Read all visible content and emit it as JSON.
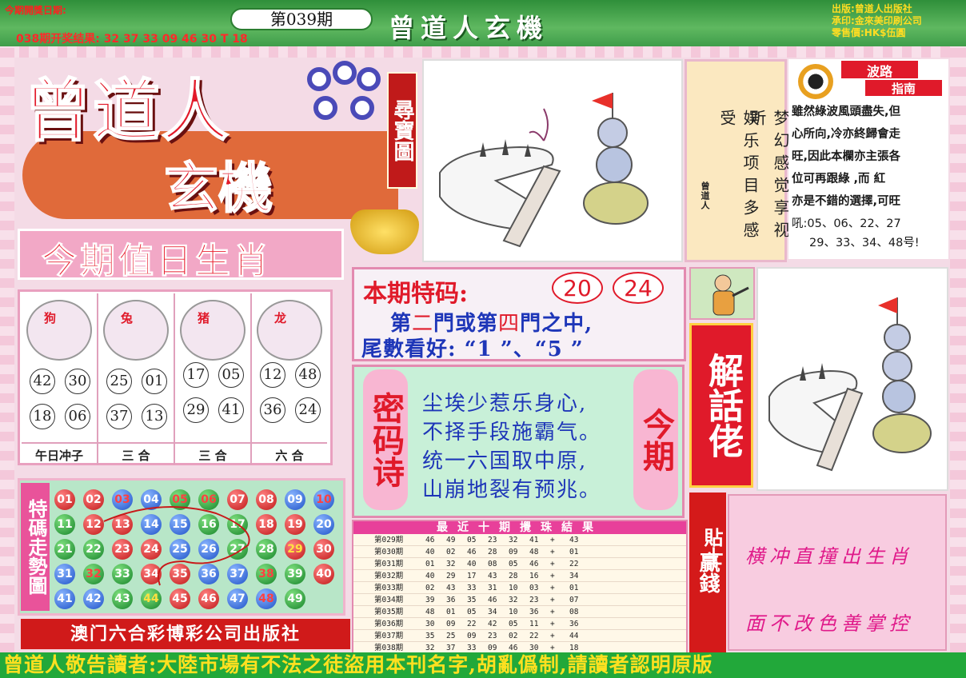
{
  "header": {
    "date_label": "今期開獎日期:",
    "last_result": "038期开奖结果: 32 37 33 09 46 30 T 18",
    "issue": "第039期",
    "title": "曾道人玄機",
    "publisher_lines": [
      "出版:曾道人出版社",
      "承印:金來美印刷公司",
      "零售價:HK$伍圓"
    ]
  },
  "logo": {
    "main": "曾道人",
    "sub": "玄機",
    "treasure_map": "尋寶圖"
  },
  "zodiac": {
    "title": "今期值日生肖",
    "columns": [
      {
        "animal": "狗",
        "numbers": [
          "42",
          "30",
          "18",
          "06"
        ],
        "label": "午日冲子"
      },
      {
        "animal": "兔",
        "numbers": [
          "25",
          "01",
          "37",
          "13"
        ],
        "label": "三 合"
      },
      {
        "animal": "猪",
        "numbers": [
          "17",
          "05",
          "29",
          "41"
        ],
        "label": "三 合"
      },
      {
        "animal": "龙",
        "numbers": [
          "12",
          "48",
          "36",
          "24"
        ],
        "label": "六 合"
      }
    ]
  },
  "trend": {
    "title": "特碼走勢圖",
    "balls": [
      {
        "n": "01",
        "c": "red"
      },
      {
        "n": "02",
        "c": "red"
      },
      {
        "n": "03",
        "c": "blue",
        "hl": "r"
      },
      {
        "n": "04",
        "c": "blue"
      },
      {
        "n": "05",
        "c": "green",
        "hl": "r"
      },
      {
        "n": "06",
        "c": "green",
        "hl": "r"
      },
      {
        "n": "07",
        "c": "red"
      },
      {
        "n": "08",
        "c": "red"
      },
      {
        "n": "09",
        "c": "blue"
      },
      {
        "n": "10",
        "c": "blue",
        "hl": "r"
      },
      {
        "n": "11",
        "c": "green"
      },
      {
        "n": "12",
        "c": "red"
      },
      {
        "n": "13",
        "c": "red"
      },
      {
        "n": "14",
        "c": "blue"
      },
      {
        "n": "15",
        "c": "blue"
      },
      {
        "n": "16",
        "c": "green"
      },
      {
        "n": "17",
        "c": "green"
      },
      {
        "n": "18",
        "c": "red"
      },
      {
        "n": "19",
        "c": "red"
      },
      {
        "n": "20",
        "c": "blue"
      },
      {
        "n": "21",
        "c": "green"
      },
      {
        "n": "22",
        "c": "green"
      },
      {
        "n": "23",
        "c": "red"
      },
      {
        "n": "24",
        "c": "red"
      },
      {
        "n": "25",
        "c": "blue"
      },
      {
        "n": "26",
        "c": "blue"
      },
      {
        "n": "27",
        "c": "green"
      },
      {
        "n": "28",
        "c": "green"
      },
      {
        "n": "29",
        "c": "red",
        "hl": "y"
      },
      {
        "n": "30",
        "c": "red"
      },
      {
        "n": "31",
        "c": "blue"
      },
      {
        "n": "32",
        "c": "green",
        "hl": "r"
      },
      {
        "n": "33",
        "c": "green"
      },
      {
        "n": "34",
        "c": "red"
      },
      {
        "n": "35",
        "c": "red"
      },
      {
        "n": "36",
        "c": "blue"
      },
      {
        "n": "37",
        "c": "blue"
      },
      {
        "n": "38",
        "c": "green",
        "hl": "r"
      },
      {
        "n": "39",
        "c": "green"
      },
      {
        "n": "40",
        "c": "red"
      },
      {
        "n": "41",
        "c": "blue"
      },
      {
        "n": "42",
        "c": "blue"
      },
      {
        "n": "43",
        "c": "green"
      },
      {
        "n": "44",
        "c": "green",
        "hl": "y"
      },
      {
        "n": "45",
        "c": "red"
      },
      {
        "n": "46",
        "c": "red"
      },
      {
        "n": "47",
        "c": "blue"
      },
      {
        "n": "48",
        "c": "blue",
        "hl": "r"
      },
      {
        "n": "49",
        "c": "green"
      }
    ],
    "publisher": "澳门六合彩博彩公司出版社"
  },
  "poem_box": {
    "signature": "曾道人",
    "col1": "梦幻感觉享视听",
    "col2": "娱乐项目多感受"
  },
  "wave": {
    "title1": "波路",
    "title2": "指南",
    "lines": [
      "雖然綠波風頭盡失,但",
      "心所向,冷亦終歸會走",
      "旺,因此本欄亦主張各",
      "位可再跟綠 ,而 紅",
      "亦是不錯的選擇,可旺",
      "吼:05、06、22、27",
      "29、33、34、48号!"
    ]
  },
  "special": {
    "label": "本期特码:",
    "numbers": [
      "20",
      "24"
    ],
    "line1_a": "第",
    "line1_b": "二",
    "line1_c": "門或第",
    "line1_d": "四",
    "line1_e": "門之中,",
    "line2": "尾數看好: “1 ”、“5 ”"
  },
  "secret_poem": {
    "left": "密码诗",
    "right": "今期",
    "lines": [
      "尘埃少惹乐身心,",
      "不择手段施霸气。",
      "统一六国取中原,",
      "山崩地裂有预兆。"
    ]
  },
  "results": {
    "title": "最近十期攪珠結果",
    "rows": [
      {
        "issue": "第029期",
        "nums": [
          "46",
          "49",
          "05",
          "23",
          "32",
          "41",
          "+",
          "43"
        ]
      },
      {
        "issue": "第030期",
        "nums": [
          "40",
          "02",
          "46",
          "28",
          "09",
          "48",
          "+",
          "01"
        ]
      },
      {
        "issue": "第031期",
        "nums": [
          "01",
          "32",
          "40",
          "08",
          "05",
          "46",
          "+",
          "22"
        ]
      },
      {
        "issue": "第032期",
        "nums": [
          "40",
          "29",
          "17",
          "43",
          "28",
          "16",
          "+",
          "34"
        ]
      },
      {
        "issue": "第033期",
        "nums": [
          "02",
          "43",
          "33",
          "31",
          "10",
          "03",
          "+",
          "01"
        ]
      },
      {
        "issue": "第034期",
        "nums": [
          "39",
          "36",
          "35",
          "46",
          "32",
          "23",
          "+",
          "07"
        ]
      },
      {
        "issue": "第035期",
        "nums": [
          "48",
          "01",
          "05",
          "34",
          "10",
          "36",
          "+",
          "08"
        ]
      },
      {
        "issue": "第036期",
        "nums": [
          "30",
          "09",
          "22",
          "42",
          "05",
          "11",
          "+",
          "36"
        ]
      },
      {
        "issue": "第037期",
        "nums": [
          "35",
          "25",
          "09",
          "23",
          "02",
          "22",
          "+",
          "44"
        ]
      },
      {
        "issue": "第038期",
        "nums": [
          "32",
          "37",
          "33",
          "09",
          "46",
          "30",
          "+",
          "18"
        ]
      }
    ]
  },
  "jiehua": "解話佬",
  "win_tip": {
    "label": "贏錢",
    "label2": "貼士",
    "line1": "横冲直撞出生肖",
    "line2": "面不改色善掌控"
  },
  "footer": "曾道人敬告讀者:大陸市場有不法之徒盜用本刊名字,胡亂僞制,請讀者認明原版"
}
